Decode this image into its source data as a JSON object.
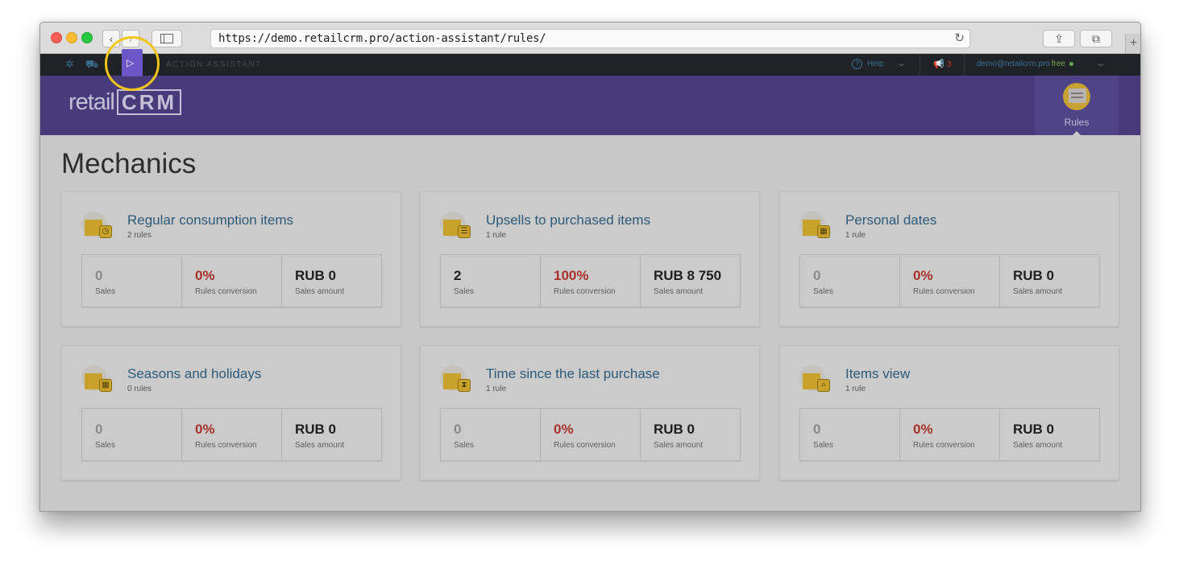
{
  "browser": {
    "url": "https://demo.retailcrm.pro/action-assistant/rules/",
    "back": "‹",
    "forward": "›",
    "reload": "↻",
    "share": "⇪",
    "tabs": "⧉",
    "new_tab": "+"
  },
  "topbar": {
    "title": "ACTION ASSISTANT",
    "help": "Help",
    "notifications_count": "3",
    "user_email": "demo@retailcrm.pro",
    "plan": "free"
  },
  "header": {
    "logo_text": "retail",
    "logo_crm": "CRM",
    "rules_tab": "Rules"
  },
  "page": {
    "title": "Mechanics"
  },
  "cards": [
    {
      "title": "Regular consumption items",
      "subtitle": "2 rules",
      "badge": "◷",
      "stats": [
        {
          "value": "0",
          "label": "Sales"
        },
        {
          "value": "0%",
          "label": "Rules conversion"
        },
        {
          "value": "RUB 0",
          "label": "Sales amount"
        }
      ]
    },
    {
      "title": "Upsells to purchased items",
      "subtitle": "1 rule",
      "badge": "☰",
      "stats": [
        {
          "value": "2",
          "label": "Sales"
        },
        {
          "value": "100%",
          "label": "Rules conversion"
        },
        {
          "value": "RUB 8 750",
          "label": "Sales amount"
        }
      ]
    },
    {
      "title": "Personal dates",
      "subtitle": "1 rule",
      "badge": "▦",
      "stats": [
        {
          "value": "0",
          "label": "Sales"
        },
        {
          "value": "0%",
          "label": "Rules conversion"
        },
        {
          "value": "RUB 0",
          "label": "Sales amount"
        }
      ]
    },
    {
      "title": "Seasons and holidays",
      "subtitle": "0 rules",
      "badge": "▦",
      "stats": [
        {
          "value": "0",
          "label": "Sales"
        },
        {
          "value": "0%",
          "label": "Rules conversion"
        },
        {
          "value": "RUB 0",
          "label": "Sales amount"
        }
      ]
    },
    {
      "title": "Time since the last purchase",
      "subtitle": "1 rule",
      "badge": "⧗",
      "stats": [
        {
          "value": "0",
          "label": "Sales"
        },
        {
          "value": "0%",
          "label": "Rules conversion"
        },
        {
          "value": "RUB 0",
          "label": "Sales amount"
        }
      ]
    },
    {
      "title": "Items view",
      "subtitle": "1 rule",
      "badge": "⌕",
      "stats": [
        {
          "value": "0",
          "label": "Sales"
        },
        {
          "value": "0%",
          "label": "Rules conversion"
        },
        {
          "value": "RUB 0",
          "label": "Sales amount"
        }
      ]
    }
  ],
  "colors": {
    "header_bg": "#473b7c",
    "accent_yellow": "#f2c618",
    "conversion_red": "#a8312a",
    "link_blue": "#2e5a7a"
  }
}
